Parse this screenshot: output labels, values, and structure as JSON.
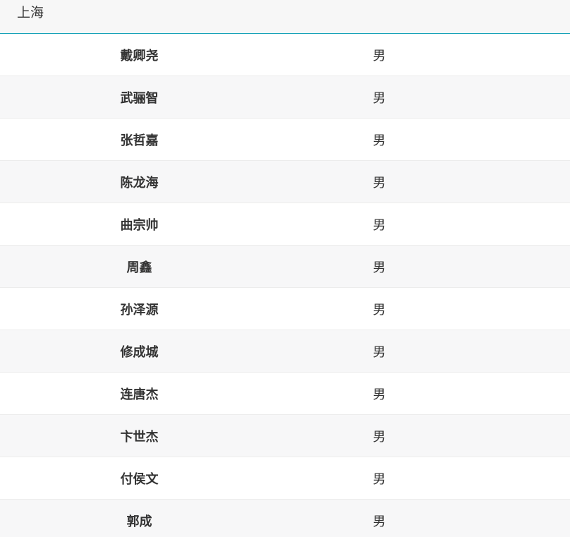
{
  "header": {
    "title": "上海"
  },
  "rows": [
    {
      "name": "戴卿尧",
      "gender": "男"
    },
    {
      "name": "武骊智",
      "gender": "男"
    },
    {
      "name": "张哲嘉",
      "gender": "男"
    },
    {
      "name": "陈龙海",
      "gender": "男"
    },
    {
      "name": "曲宗帅",
      "gender": "男"
    },
    {
      "name": "周鑫",
      "gender": "男"
    },
    {
      "name": "孙泽源",
      "gender": "男"
    },
    {
      "name": "修成城",
      "gender": "男"
    },
    {
      "name": "连唐杰",
      "gender": "男"
    },
    {
      "name": "卞世杰",
      "gender": "男"
    },
    {
      "name": "付侯文",
      "gender": "男"
    },
    {
      "name": "郭成",
      "gender": "男"
    }
  ]
}
